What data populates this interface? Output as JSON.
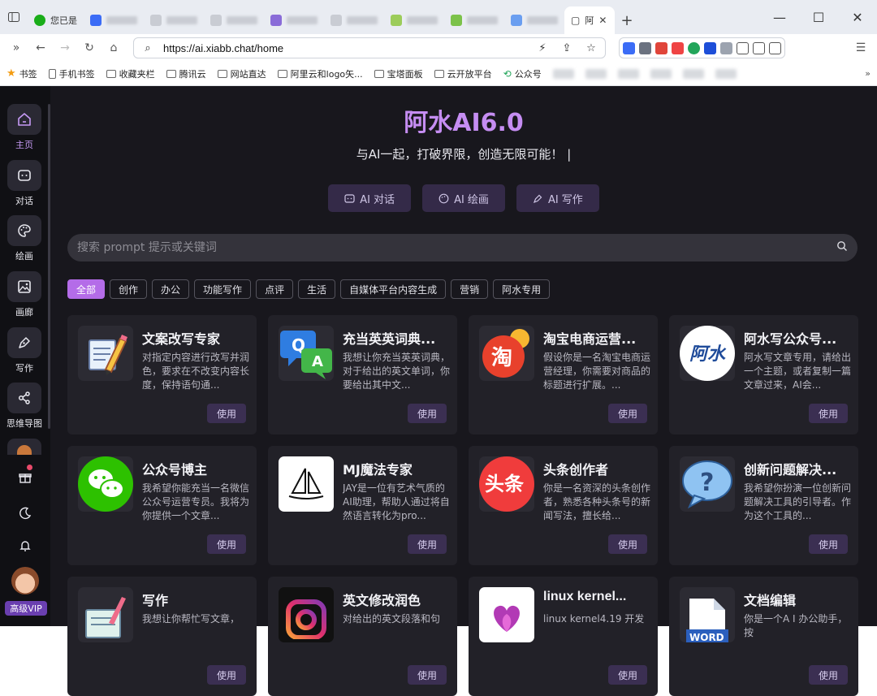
{
  "browser": {
    "tabs": [
      {
        "label": "您已是",
        "color": "#1aad19"
      },
      {
        "label": "",
        "color": "#3b6cf6"
      },
      {
        "label": "",
        "color": "#c9ccd3"
      },
      {
        "label": "",
        "color": "#c9ccd3"
      },
      {
        "label": "",
        "color": "#c9ccd3"
      },
      {
        "label": "",
        "color": "#8a6cd8"
      },
      {
        "label": "",
        "color": "#c9ccd3"
      },
      {
        "label": "",
        "color": "#c9ccd3"
      },
      {
        "label": "",
        "color": "#9ccc5a"
      },
      {
        "label": "",
        "color": "#7cc24a"
      },
      {
        "label": "",
        "color": "#6a9ef0"
      }
    ],
    "active_tab": {
      "label": "阿",
      "close": "✕"
    },
    "url": "https://ai.xiabb.chat/home",
    "bookmarks": [
      "书签",
      "手机书签",
      "收藏夹栏",
      "腾讯云",
      "网站直达",
      "阿里云和logo矢...",
      "宝塔面板",
      "云开放平台",
      "公众号"
    ]
  },
  "sidebar": {
    "items": [
      {
        "label": "主页",
        "icon": "home-icon"
      },
      {
        "label": "对话",
        "icon": "chat-icon"
      },
      {
        "label": "绘画",
        "icon": "palette-icon"
      },
      {
        "label": "画廊",
        "icon": "image-icon"
      },
      {
        "label": "写作",
        "icon": "pen-icon"
      },
      {
        "label": "思维导图",
        "icon": "mindmap-icon"
      }
    ],
    "vip_label": "高级VIP"
  },
  "hero": {
    "title": "阿水AI6.0",
    "subtitle": "与AI一起，打破界限，创造无限可能！ |",
    "buttons": [
      {
        "label": "AI 对话",
        "icon": "chat-icon"
      },
      {
        "label": "AI 绘画",
        "icon": "palette-icon"
      },
      {
        "label": "AI 写作",
        "icon": "pen-icon"
      }
    ]
  },
  "search": {
    "placeholder": "搜索 prompt 提示或关键词"
  },
  "categories": [
    "全部",
    "创作",
    "办公",
    "功能写作",
    "点评",
    "生活",
    "自媒体平台内容生成",
    "营销",
    "阿水专用"
  ],
  "active_category": "全部",
  "cards": [
    {
      "title": "文案改写专家",
      "desc": "对指定内容进行改写并润色，要求在不改变内容长度，保持语句通...",
      "use": "使用",
      "thumb": "pencil-notepad-icon"
    },
    {
      "title": "充当英英词典...",
      "desc": "我想让你充当英英词典，对于给出的英文单词，你要给出其中文...",
      "use": "使用",
      "thumb": "qa-bubbles-icon"
    },
    {
      "title": "淘宝电商运营...",
      "desc": "假设你是一名淘宝电商运营经理，你需要对商品的标题进行扩展。...",
      "use": "使用",
      "thumb": "taobao-icon"
    },
    {
      "title": "阿水写公众号...",
      "desc": "阿水写文章专用，请给出一个主题，或者复制一篇文章过来，AI会...",
      "use": "使用",
      "thumb": "ashui-logo-icon"
    },
    {
      "title": "公众号博主",
      "desc": "我希望你能充当一名微信公众号运营专员。我将为你提供一个文章...",
      "use": "使用",
      "thumb": "wechat-icon"
    },
    {
      "title": "MJ魔法专家",
      "desc": "JAY是一位有艺术气质的AI助理，帮助人通过将自然语言转化为pro...",
      "use": "使用",
      "thumb": "sailboat-icon"
    },
    {
      "title": "头条创作者",
      "desc": "你是一名资深的头条创作者，熟悉各种头条号的新闻写法，擅长给...",
      "use": "使用",
      "thumb": "toutiao-icon"
    },
    {
      "title": "创新问题解决...",
      "desc": "我希望你扮演一位创新问题解决工具的引导者。作为这个工具的...",
      "use": "使用",
      "thumb": "question-bubble-icon"
    },
    {
      "title": "写作",
      "desc": "我想让你帮忙写文章，",
      "use": "使用",
      "thumb": "notebook-pen-icon"
    },
    {
      "title": "英文修改润色",
      "desc": "对给出的英文段落和句",
      "use": "使用",
      "thumb": "instagram-icon"
    },
    {
      "title": "linux kernel...",
      "desc": "linux kernel4.19 开发",
      "use": "使用",
      "thumb": "heart-logo-icon"
    },
    {
      "title": "文档编辑",
      "desc": "你是一个A I 办公助手，按",
      "use": "使用",
      "thumb": "word-doc-icon"
    }
  ]
}
